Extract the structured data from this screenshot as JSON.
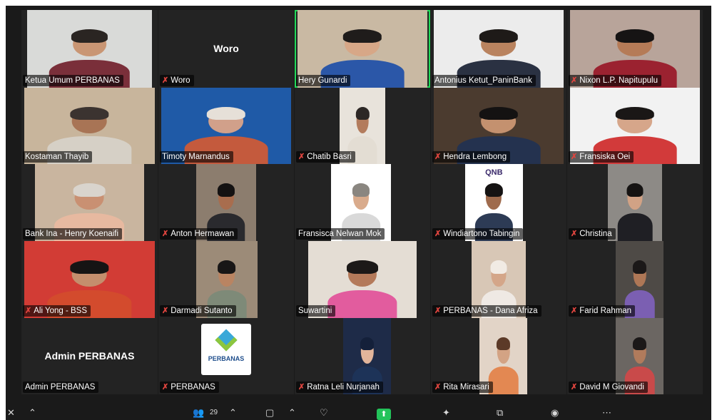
{
  "meeting": {
    "participants": [
      {
        "name": "Ketua Umum PERBANAS",
        "muted": false,
        "video": true,
        "bg": "#d9dad8",
        "skin": "#c99674",
        "shirt": "#7a2f3a",
        "hair": "#2a2522"
      },
      {
        "name": "Woro",
        "muted": true,
        "video": false
      },
      {
        "name": "Hery Gunardi",
        "muted": false,
        "video": true,
        "active": true,
        "bg": "#c9b9a3",
        "skin": "#d7a787",
        "shirt": "#2b57a8",
        "hair": "#1f1c1b"
      },
      {
        "name": "Antonius Ketut_PaninBank",
        "muted": false,
        "video": true,
        "bg": "#ececec",
        "skin": "#b9835f",
        "shirt": "#2a3142",
        "hair": "#1e1a18"
      },
      {
        "name": "Nixon L.P. Napitupulu",
        "muted": true,
        "video": true,
        "bg": "#b8a49a",
        "skin": "#b57b57",
        "shirt": "#9b2230",
        "hair": "#161414"
      },
      {
        "name": "Kostaman Thayib",
        "muted": false,
        "video": true,
        "bg": "#c8b59c",
        "skin": "#a87455",
        "shirt": "#d6d0c6",
        "hair": "#3b3330"
      },
      {
        "name": "Timoty Marnandus",
        "muted": false,
        "video": true,
        "bg": "#1f5aa7",
        "skin": "#d1a08a",
        "shirt": "#c45a3d",
        "hair": "#e6e0d8"
      },
      {
        "name": "Chatib Basri",
        "muted": true,
        "video": true,
        "bg": "#e8e3db",
        "skin": "#b37c5d",
        "shirt": "#e3ddd3",
        "hair": "#2c2725"
      },
      {
        "name": "Hendra Lembong",
        "muted": true,
        "video": true,
        "bg": "#4b3b2f",
        "skin": "#c4916f",
        "shirt": "#24324f",
        "hair": "#141212"
      },
      {
        "name": "Fransiska Oei",
        "muted": true,
        "video": true,
        "bg": "#f2f2f2",
        "skin": "#d6a68a",
        "shirt": "#d23a3a",
        "hair": "#1a1716"
      },
      {
        "name": "Bank Ina - Henry Koenaifi",
        "muted": false,
        "video": true,
        "bg": "#c9b59f",
        "skin": "#c99072",
        "shirt": "#e7b9a0",
        "hair": "#d9d4cd"
      },
      {
        "name": "Anton Hermawan",
        "muted": true,
        "video": true,
        "bg": "#8c7d6e",
        "skin": "#a86d4e",
        "shirt": "#2a2a2e",
        "hair": "#141212"
      },
      {
        "name": "Fransisca Nelwan Mok",
        "muted": false,
        "video": true,
        "bg": "#ffffff",
        "skin": "#d9ab8c",
        "shirt": "#d9d9d9",
        "hair": "#8a8680"
      },
      {
        "name": "Windiartono Tabingin",
        "muted": true,
        "video": true,
        "bg": "#ffffff",
        "skin": "#9f6b4d",
        "shirt": "#2d3b55",
        "hair": "#151313",
        "brand": "QNB"
      },
      {
        "name": "Christina",
        "muted": true,
        "video": true,
        "bg": "#8d8a86",
        "skin": "#d1a285",
        "shirt": "#1f1f24",
        "hair": "#151312"
      },
      {
        "name": "Ali Yong - BSS",
        "muted": true,
        "video": true,
        "bg": "#d23c35",
        "skin": "#c48e6d",
        "shirt": "#d34b2d",
        "hair": "#161414"
      },
      {
        "name": "Darmadi Sutanto",
        "muted": true,
        "video": true,
        "bg": "#9c8b78",
        "skin": "#b98462",
        "shirt": "#7e8a78",
        "hair": "#181616"
      },
      {
        "name": "Suwartini",
        "muted": false,
        "video": true,
        "bg": "#e4ddd4",
        "skin": "#b47a5a",
        "shirt": "#e25c9e",
        "hair": "#1c1918"
      },
      {
        "name": "PERBANAS - Dana Afriza",
        "muted": true,
        "video": true,
        "bg": "#d8c7b6",
        "skin": "#d4a689",
        "shirt": "#efe9e4",
        "hair": "#f1ebe4"
      },
      {
        "name": "Farid Rahman",
        "muted": true,
        "video": true,
        "bg": "#4e4a46",
        "skin": "#ae7756",
        "shirt": "#7b5fb2",
        "hair": "#1b1818"
      },
      {
        "name": "Admin PERBANAS",
        "muted": false,
        "video": false
      },
      {
        "name": "PERBANAS",
        "muted": true,
        "video": false,
        "logo": true
      },
      {
        "name": "Ratna Leli Nurjanah",
        "muted": true,
        "video": true,
        "bg": "#1e2b48",
        "skin": "#e2b59b",
        "shirt": "#1d3358",
        "hair": "#14203a"
      },
      {
        "name": "Rita Mirasari",
        "muted": true,
        "video": true,
        "bg": "#e2d4c7",
        "skin": "#d3a384",
        "shirt": "#e38852",
        "hair": "#5c3a28"
      },
      {
        "name": "David M Giovandi",
        "muted": true,
        "video": true,
        "bg": "#6b6662",
        "skin": "#b07b5c",
        "shirt": "#c94a4a",
        "hair": "#1b1818"
      }
    ]
  },
  "toolbar": {
    "participants_count": "29"
  },
  "colors": {
    "stage_bg": "#1a1a1a",
    "tile_bg": "#232323",
    "active_speaker": "#23d959",
    "muted": "#e0453f",
    "share_green": "#23c35a"
  }
}
